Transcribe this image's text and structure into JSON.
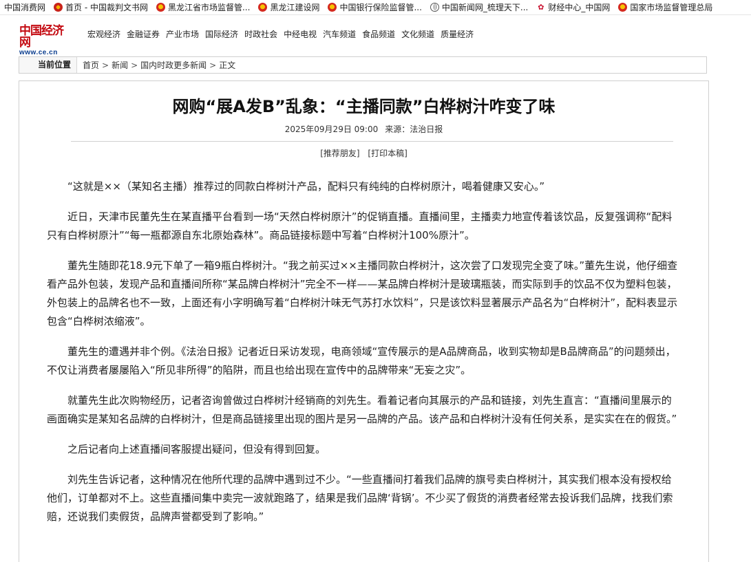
{
  "bookmarks": [
    {
      "label": "中国消费网",
      "icon": "none"
    },
    {
      "label": "首页 - 中国裁判文书网",
      "icon": "court-emblem-icon"
    },
    {
      "label": "黑龙江省市场监督管...",
      "icon": "national-emblem-icon"
    },
    {
      "label": "黑龙江建设网",
      "icon": "national-emblem-icon"
    },
    {
      "label": "中国银行保险监督管...",
      "icon": "national-emblem-icon"
    },
    {
      "label": "中国新闻网_梳理天下...",
      "icon": "globe-icon"
    },
    {
      "label": "财经中心_中国网",
      "icon": "caijing-icon"
    },
    {
      "label": "国家市场监督管理总局",
      "icon": "national-emblem-icon"
    }
  ],
  "site": {
    "logo_cn": "中国经济网",
    "logo_url": "www.ce.cn",
    "nav": [
      "宏观经济",
      "金融证券",
      "产业市场",
      "国际经济",
      "时政社会",
      "中经电视",
      "汽车频道",
      "食品频道",
      "文化频道",
      "质量经济"
    ]
  },
  "breadcrumb": {
    "label": "当前位置",
    "items": [
      "首页",
      "新闻",
      "国内时政更多新闻",
      "正文"
    ],
    "separator": ">"
  },
  "article": {
    "title": "网购“展A发B”乱象：“主播同款”白桦树汁咋变了味",
    "date": "2025年09月29日 09:00",
    "source": "来源：法治日报",
    "tools": [
      "[推荐朋友]",
      "[打印本稿]"
    ],
    "paragraphs": [
      "“这就是××（某知名主播）推荐过的同款白桦树汁产品，配料只有纯纯的白桦树原汁，喝着健康又安心。”",
      "近日，天津市民董先生在某直播平台看到一场“天然白桦树原汁”的促销直播。直播间里，主播卖力地宣传着该饮品，反复强调称“配料只有白桦树原汁”“每一瓶都源自东北原始森林”。商品链接标题中写着“白桦树汁100%原汁”。",
      "董先生随即花18.9元下单了一箱9瓶白桦树汁。“我之前买过××主播同款白桦树汁，这次尝了口发现完全变了味。”董先生说，他仔细查看产品外包装，发现产品和直播间所称“某品牌白桦树汁”完全不一样——某品牌白桦树汁是玻璃瓶装，而实际到手的饮品不仅为塑料包装，外包装上的品牌名也不一致，上面还有小字明确写着“白桦树汁味无气苏打水饮料”，只是该饮料显著展示产品名为“白桦树汁”，配料表显示包含“白桦树浓缩液”。",
      "董先生的遭遇并非个例。《法治日报》记者近日采访发现，电商领域“宣传展示的是A品牌商品，收到实物却是B品牌商品”的问题频出，不仅让消费者屡屡陷入“所见非所得”的陷阱，而且也给出现在宣传中的品牌带来“无妄之灾”。",
      "就董先生此次购物经历，记者咨询曾做过白桦树汁经销商的刘先生。看着记者向其展示的产品和链接，刘先生直言：“直播间里展示的画面确实是某知名品牌的白桦树汁，但是商品链接里出现的图片是另一品牌的产品。该产品和白桦树汁没有任何关系，是实实在在的假货。”",
      "之后记者向上述直播间客服提出疑问，但没有得到回复。",
      "刘先生告诉记者，这种情况在他所代理的品牌中遇到过不少。“一些直播间打着我们品牌的旗号卖白桦树汁，其实我们根本没有授权给他们，订单都对不上。这些直播间集中卖完一波就跑路了，结果是我们品牌‘背锅’。不少买了假货的消费者经常去投诉我们品牌，找我们索赔，还说我们卖假货，品牌声誉都受到了影响。”"
    ]
  }
}
